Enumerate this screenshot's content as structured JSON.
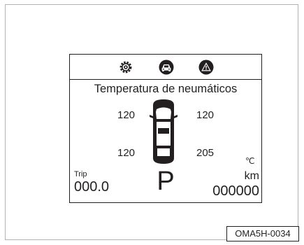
{
  "display": {
    "tabs": [
      {
        "icon": "gear-icon"
      },
      {
        "icon": "car-front-icon",
        "active": true
      },
      {
        "icon": "warning-triangle-icon"
      }
    ],
    "title": "Temperatura de neumáticos",
    "tires": {
      "front_left": "120",
      "front_right": "120",
      "rear_left": "120",
      "rear_right": "205"
    },
    "temp_unit": "℃",
    "trip_label": "Trip",
    "trip_value": "000.0",
    "gear": "P",
    "distance_unit": "km",
    "odometer": "000000"
  },
  "figure_code": "OMA5H-0034",
  "colors": {
    "ink": "#231f20",
    "frame": "#b3b3b3",
    "background": "#ffffff"
  }
}
